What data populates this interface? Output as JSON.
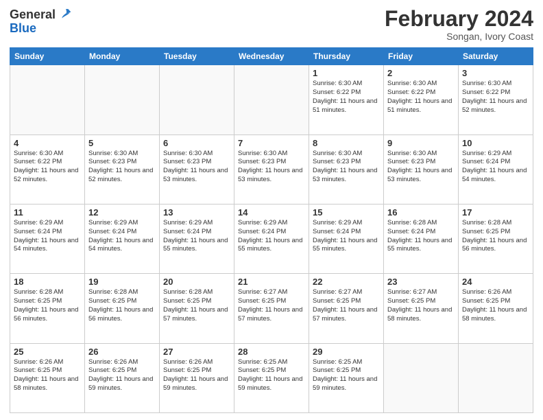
{
  "header": {
    "logo_general": "General",
    "logo_blue": "Blue",
    "title": "February 2024",
    "subtitle": "Songan, Ivory Coast"
  },
  "days_of_week": [
    "Sunday",
    "Monday",
    "Tuesday",
    "Wednesday",
    "Thursday",
    "Friday",
    "Saturday"
  ],
  "weeks": [
    [
      {
        "day": "",
        "info": ""
      },
      {
        "day": "",
        "info": ""
      },
      {
        "day": "",
        "info": ""
      },
      {
        "day": "",
        "info": ""
      },
      {
        "day": "1",
        "info": "Sunrise: 6:30 AM\nSunset: 6:22 PM\nDaylight: 11 hours\nand 51 minutes."
      },
      {
        "day": "2",
        "info": "Sunrise: 6:30 AM\nSunset: 6:22 PM\nDaylight: 11 hours\nand 51 minutes."
      },
      {
        "day": "3",
        "info": "Sunrise: 6:30 AM\nSunset: 6:22 PM\nDaylight: 11 hours\nand 52 minutes."
      }
    ],
    [
      {
        "day": "4",
        "info": "Sunrise: 6:30 AM\nSunset: 6:22 PM\nDaylight: 11 hours\nand 52 minutes."
      },
      {
        "day": "5",
        "info": "Sunrise: 6:30 AM\nSunset: 6:23 PM\nDaylight: 11 hours\nand 52 minutes."
      },
      {
        "day": "6",
        "info": "Sunrise: 6:30 AM\nSunset: 6:23 PM\nDaylight: 11 hours\nand 53 minutes."
      },
      {
        "day": "7",
        "info": "Sunrise: 6:30 AM\nSunset: 6:23 PM\nDaylight: 11 hours\nand 53 minutes."
      },
      {
        "day": "8",
        "info": "Sunrise: 6:30 AM\nSunset: 6:23 PM\nDaylight: 11 hours\nand 53 minutes."
      },
      {
        "day": "9",
        "info": "Sunrise: 6:30 AM\nSunset: 6:23 PM\nDaylight: 11 hours\nand 53 minutes."
      },
      {
        "day": "10",
        "info": "Sunrise: 6:29 AM\nSunset: 6:24 PM\nDaylight: 11 hours\nand 54 minutes."
      }
    ],
    [
      {
        "day": "11",
        "info": "Sunrise: 6:29 AM\nSunset: 6:24 PM\nDaylight: 11 hours\nand 54 minutes."
      },
      {
        "day": "12",
        "info": "Sunrise: 6:29 AM\nSunset: 6:24 PM\nDaylight: 11 hours\nand 54 minutes."
      },
      {
        "day": "13",
        "info": "Sunrise: 6:29 AM\nSunset: 6:24 PM\nDaylight: 11 hours\nand 55 minutes."
      },
      {
        "day": "14",
        "info": "Sunrise: 6:29 AM\nSunset: 6:24 PM\nDaylight: 11 hours\nand 55 minutes."
      },
      {
        "day": "15",
        "info": "Sunrise: 6:29 AM\nSunset: 6:24 PM\nDaylight: 11 hours\nand 55 minutes."
      },
      {
        "day": "16",
        "info": "Sunrise: 6:28 AM\nSunset: 6:24 PM\nDaylight: 11 hours\nand 55 minutes."
      },
      {
        "day": "17",
        "info": "Sunrise: 6:28 AM\nSunset: 6:25 PM\nDaylight: 11 hours\nand 56 minutes."
      }
    ],
    [
      {
        "day": "18",
        "info": "Sunrise: 6:28 AM\nSunset: 6:25 PM\nDaylight: 11 hours\nand 56 minutes."
      },
      {
        "day": "19",
        "info": "Sunrise: 6:28 AM\nSunset: 6:25 PM\nDaylight: 11 hours\nand 56 minutes."
      },
      {
        "day": "20",
        "info": "Sunrise: 6:28 AM\nSunset: 6:25 PM\nDaylight: 11 hours\nand 57 minutes."
      },
      {
        "day": "21",
        "info": "Sunrise: 6:27 AM\nSunset: 6:25 PM\nDaylight: 11 hours\nand 57 minutes."
      },
      {
        "day": "22",
        "info": "Sunrise: 6:27 AM\nSunset: 6:25 PM\nDaylight: 11 hours\nand 57 minutes."
      },
      {
        "day": "23",
        "info": "Sunrise: 6:27 AM\nSunset: 6:25 PM\nDaylight: 11 hours\nand 58 minutes."
      },
      {
        "day": "24",
        "info": "Sunrise: 6:26 AM\nSunset: 6:25 PM\nDaylight: 11 hours\nand 58 minutes."
      }
    ],
    [
      {
        "day": "25",
        "info": "Sunrise: 6:26 AM\nSunset: 6:25 PM\nDaylight: 11 hours\nand 58 minutes."
      },
      {
        "day": "26",
        "info": "Sunrise: 6:26 AM\nSunset: 6:25 PM\nDaylight: 11 hours\nand 59 minutes."
      },
      {
        "day": "27",
        "info": "Sunrise: 6:26 AM\nSunset: 6:25 PM\nDaylight: 11 hours\nand 59 minutes."
      },
      {
        "day": "28",
        "info": "Sunrise: 6:25 AM\nSunset: 6:25 PM\nDaylight: 11 hours\nand 59 minutes."
      },
      {
        "day": "29",
        "info": "Sunrise: 6:25 AM\nSunset: 6:25 PM\nDaylight: 11 hours\nand 59 minutes."
      },
      {
        "day": "",
        "info": ""
      },
      {
        "day": "",
        "info": ""
      }
    ]
  ]
}
